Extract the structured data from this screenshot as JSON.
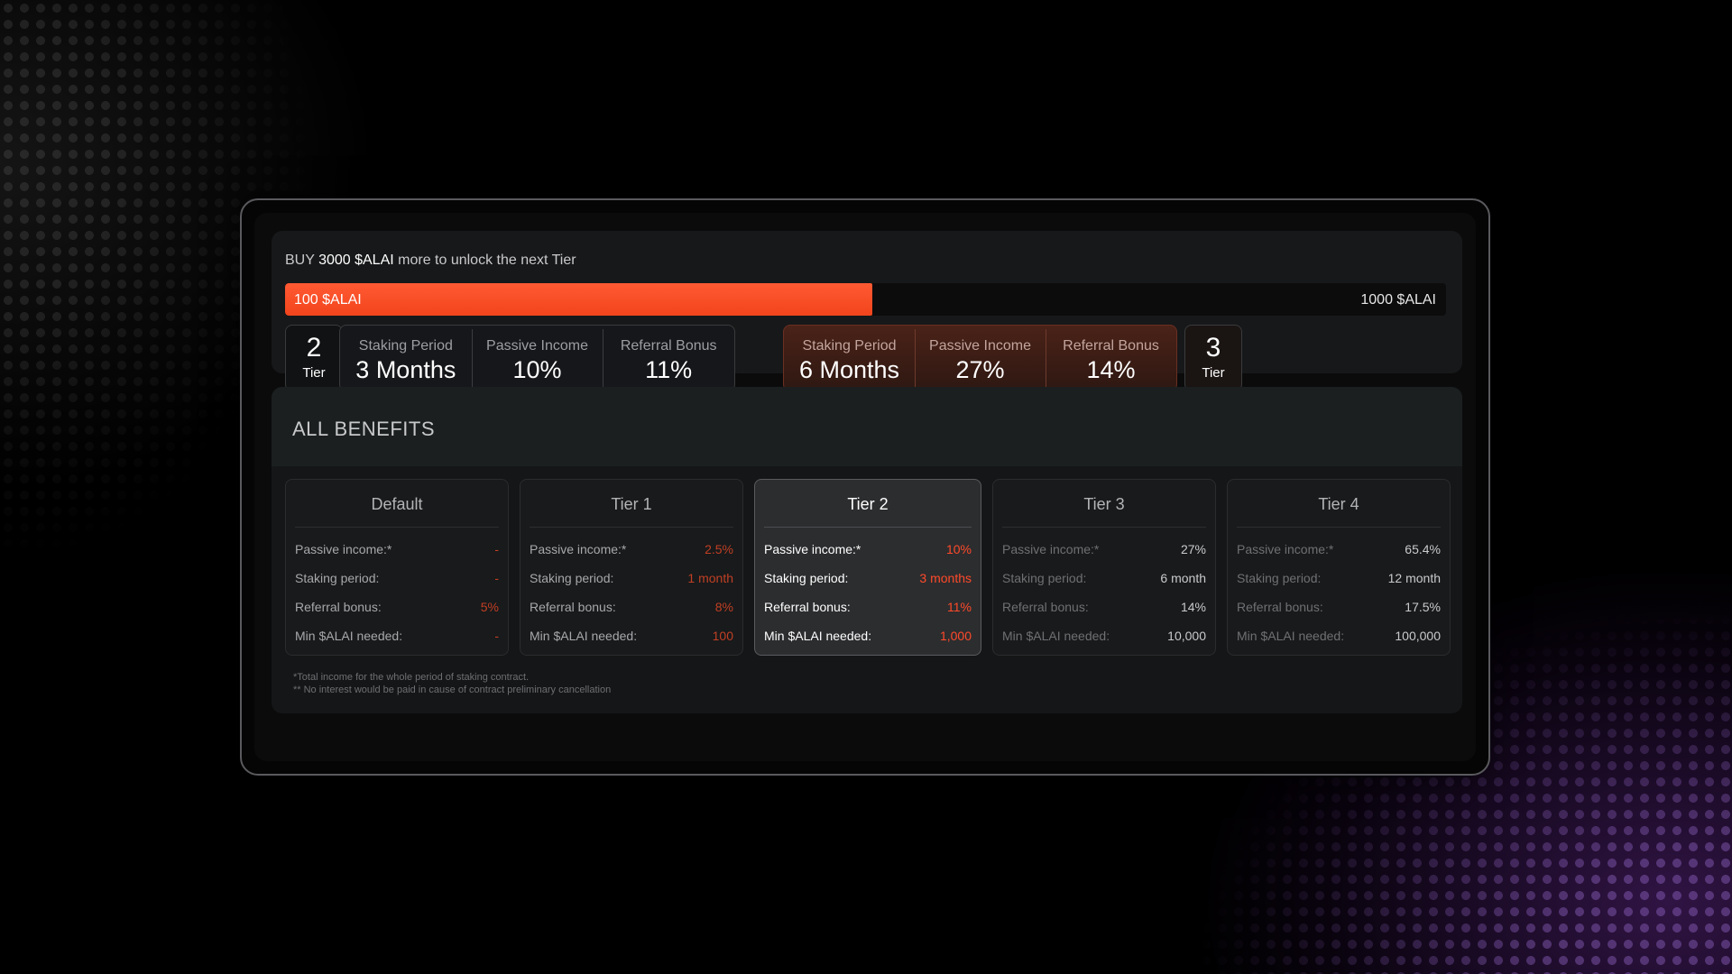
{
  "progress": {
    "buy_prefix": "BUY",
    "buy_amount": "3000 $ALAI",
    "buy_suffix": "more to unlock the next Tier",
    "bar_start": "100 $ALAI",
    "bar_end": "1000 $ALAI",
    "fill_fraction": 0.506,
    "accent_color": "#f24a22"
  },
  "current_tier": {
    "number": "2",
    "label": "Tier",
    "stats": [
      {
        "label": "Staking Period",
        "value": "3 Months"
      },
      {
        "label": "Passive Income",
        "value": "10%"
      },
      {
        "label": "Referral Bonus",
        "value": "11%"
      }
    ]
  },
  "next_tier": {
    "number": "3",
    "label": "Tier",
    "stats": [
      {
        "label": "Staking Period",
        "value": "6 Months"
      },
      {
        "label": "Passive Income",
        "value": "27%"
      },
      {
        "label": "Referral Bonus",
        "value": "14%"
      }
    ]
  },
  "arrow_icon": "chevron-right-icon",
  "benefits": {
    "title": "ALL BENEFITS",
    "row_labels": [
      "Passive income:*",
      "Staking period:",
      "Referral bonus:",
      "Min $ALAI needed:"
    ],
    "tiers": [
      {
        "name": "Default",
        "values": [
          "-",
          "-",
          "5%",
          "-"
        ]
      },
      {
        "name": "Tier 1",
        "values": [
          "2.5%",
          "1 month",
          "8%",
          "100"
        ]
      },
      {
        "name": "Tier 2",
        "values": [
          "10%",
          "3 months",
          "11%",
          "1,000"
        ]
      },
      {
        "name": "Tier 3",
        "values": [
          "27%",
          "6 month",
          "14%",
          "10,000"
        ]
      },
      {
        "name": "Tier 4",
        "values": [
          "65.4%",
          "12 month",
          "17.5%",
          "100,000"
        ]
      }
    ],
    "footnote_1": "*Total income for the whole period of staking contract.",
    "footnote_2": "** No interest would be paid in cause of contract preliminary cancellation"
  }
}
